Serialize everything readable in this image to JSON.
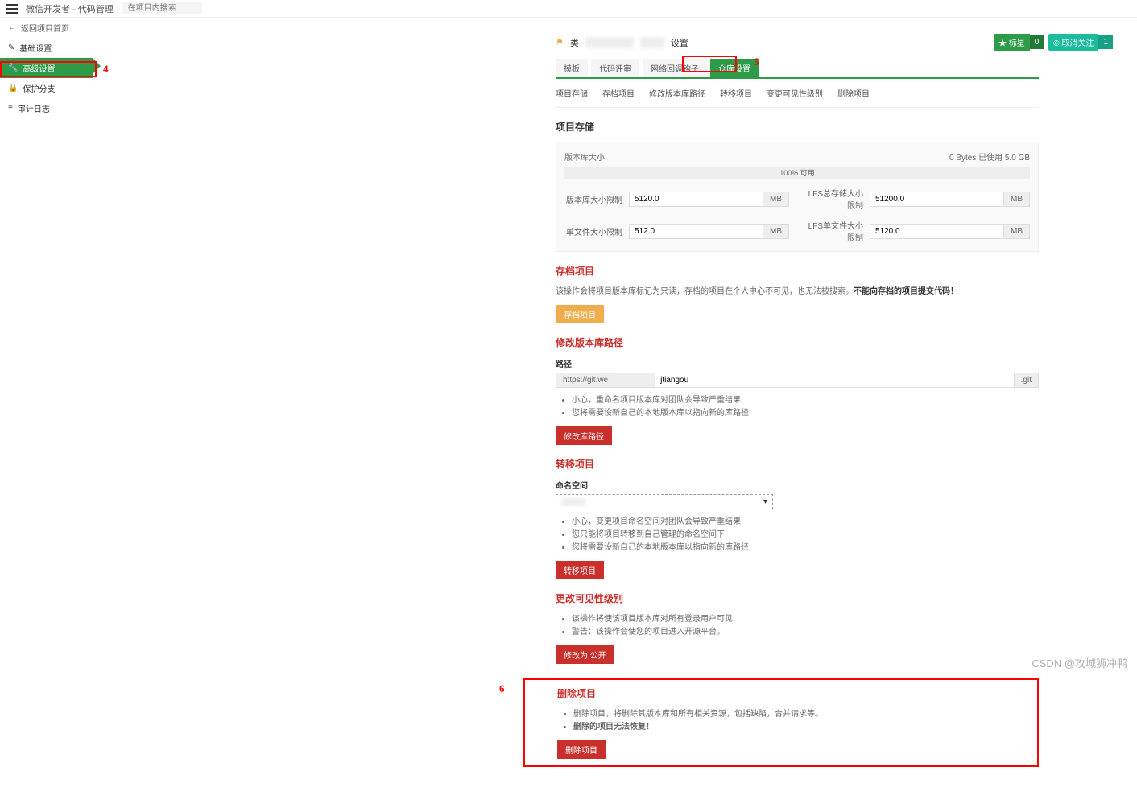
{
  "topbar": {
    "title": "微信开发者 - 代码管理",
    "search_placeholder": "在项目内搜索"
  },
  "sidebar": {
    "back": "返回项目首页",
    "items": [
      {
        "label": "基础设置"
      },
      {
        "label": "高级设置"
      },
      {
        "label": "保护分支"
      },
      {
        "label": "审计日志"
      }
    ]
  },
  "header": {
    "prefix": "类",
    "suffix": "设置",
    "star_label": "★ 标星",
    "star_count": "0",
    "follow_label": "© 取消关注",
    "follow_count": "1"
  },
  "tabs": [
    "模板",
    "代码评审",
    "网络回调钩子",
    "仓库设置"
  ],
  "subtabs": [
    "项目存储",
    "存档项目",
    "修改版本库路径",
    "转移项目",
    "变更可见性级别",
    "删除项目"
  ],
  "storage": {
    "title": "项目存储",
    "size_label": "版本库大小",
    "size_value": "0 Bytes 已使用 5.0 GB",
    "progress_text": "100% 可用",
    "rows": [
      {
        "l1": "版本库大小限制",
        "v1": "5120.0",
        "u1": "MB",
        "l2": "LFS总存储大小限制",
        "v2": "51200.0",
        "u2": "MB"
      },
      {
        "l1": "单文件大小限制",
        "v1": "512.0",
        "u1": "MB",
        "l2": "LFS单文件大小限制",
        "v2": "5120.0",
        "u2": "MB"
      }
    ]
  },
  "archive": {
    "title": "存档项目",
    "note1": "该操作会将项目版本库标记为只读，存档的项目在个人中心不可见，也无法被搜索。",
    "note2": "不能向存档的项目提交代码！",
    "btn": "存档项目"
  },
  "path": {
    "title": "修改版本库路径",
    "label": "路径",
    "prefix": "https://git.we",
    "value": "jtiangou",
    "suffix": ".git",
    "bullets": [
      "小心，重命名项目版本库对团队会导致严重结果",
      "您将需要设新自己的本地版本库以指向新的库路径"
    ],
    "btn": "修改库路径"
  },
  "transfer": {
    "title": "转移项目",
    "label": "命名空间",
    "select_value": "",
    "bullets": [
      "小心，变更项目命名空间对团队会导致严重结果",
      "您只能将项目转移到自己管理的命名空间下",
      "您将需要设新自己的本地版本库以指向新的库路径"
    ],
    "btn": "转移项目"
  },
  "visibility": {
    "title": "更改可见性级别",
    "bullets": [
      "该操作将使该项目版本库对所有登录用户可见",
      "警告：该操作会使您的项目进入开源平台。"
    ],
    "btn": "修改为 公开"
  },
  "delete": {
    "title": "删除项目",
    "bullets": [
      "删除项目，将删除其版本库和所有相关资源，包括缺陷，合并请求等。",
      "删除的项目无法恢复！"
    ],
    "btn": "删除项目"
  },
  "annotations": {
    "a4": "4",
    "a5": "5",
    "a6": "6"
  },
  "watermark": "CSDN @攻城狮冲鸭"
}
